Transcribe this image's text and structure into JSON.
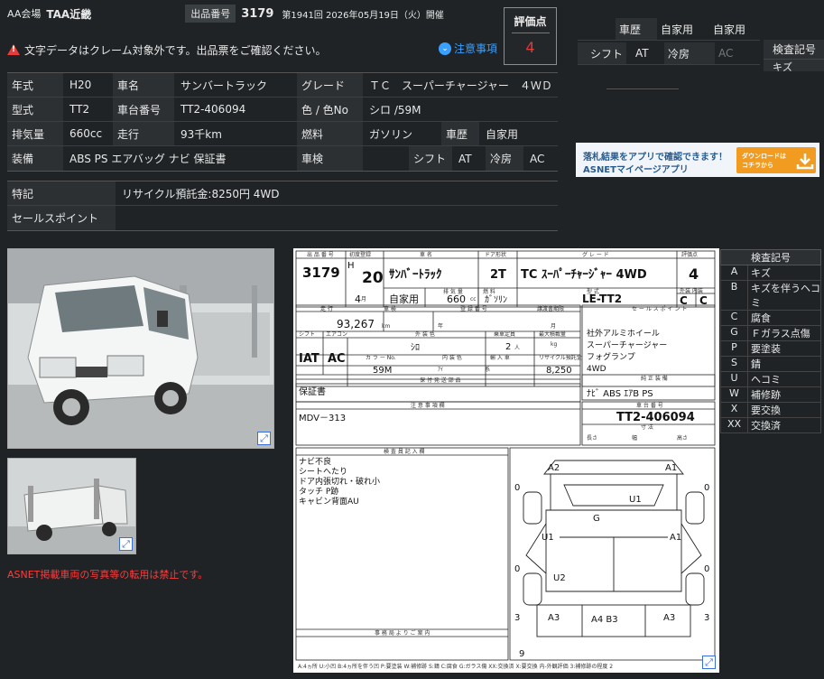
{
  "header": {
    "venue_label": "AA会場",
    "venue": "TAA近畿",
    "lot_label": "出品番号",
    "lot": "3179",
    "session": "第1941回 2026年05月19日（火）開催"
  },
  "warning": {
    "text": "文字データはクレーム対象外です。出品票をご確認ください。",
    "note_link": "注意事項"
  },
  "score": {
    "label": "評価点",
    "value": "4"
  },
  "spec": {
    "rows": [
      [
        {
          "l": "年式",
          "v": "H20"
        },
        {
          "l": "車名",
          "v": "サンバートラック"
        },
        {
          "l": "グレード",
          "v": "ＴＣ　スーパーチャージャー　４ＷＤ"
        }
      ],
      [
        {
          "l": "型式",
          "v": "TT2"
        },
        {
          "l": "車台番号",
          "v": "TT2-406094"
        },
        {
          "l": "色 / 色No",
          "v": "シロ /59M"
        }
      ],
      [
        {
          "l": "排気量",
          "v": "660cc"
        },
        {
          "l": "走行",
          "v": "93千km"
        },
        {
          "l": "燃料",
          "v": "ガソリン"
        },
        {
          "l": "車歴",
          "v": "自家用"
        }
      ],
      [
        {
          "l": "装備",
          "v": "ABS PS エアバッグ ナビ 保証書"
        },
        {
          "l": "車検",
          "v": ""
        },
        {
          "l": "シフト",
          "v": "AT"
        },
        {
          "l": "冷房",
          "v": "AC"
        }
      ]
    ]
  },
  "features": {
    "tokki_label": "特記",
    "tokki": "リサイクル預託金:8250円 4WD",
    "sales_label": "セールスポイント",
    "sales": ""
  },
  "right_table": {
    "r1": [
      "車歴",
      "自家用",
      "自家用"
    ],
    "r2": [
      "シフト",
      "AT",
      "冷房",
      "AC"
    ]
  },
  "kensa_top": {
    "label": "検査記号",
    "value": "キズ"
  },
  "banner": {
    "line1": "落札結果をアプリで確認できます！",
    "line2": "ASNETマイページアプリ",
    "btn1": "ダウンロードは",
    "btn2": "コチラから"
  },
  "photo_notice": "ASNET掲載車両の写真等の転用は禁止です。",
  "sheet": {
    "lot": "3179",
    "era": "H",
    "year": "20",
    "month": "4",
    "car": "ｻﾝﾊﾞｰﾄﾗｯｸ",
    "doors": "2T",
    "grade": "TC ｽｰﾊﾟｰﾁｬｰｼﾞｬｰ 4WD",
    "score": "4",
    "use": "自家用",
    "cc": "660",
    "fuel": "ｶﾞｿﾘﾝ",
    "model": "LE-TT2",
    "ext": "C",
    "int": "C",
    "km": "93,267",
    "shift": "IAT",
    "ac": "AC",
    "color": "ｼﾛ",
    "colorno": "59M",
    "inner": "ｱｲ",
    "seats": "2",
    "recycle": "8,250",
    "sales": [
      "社外アルミホイール",
      "スーパーチャージャー",
      "フォグランプ",
      "4WD"
    ],
    "equip": "ﾅﾋﾞ ABS ｴｱB PS",
    "warranty": "保証書",
    "vin": "TT2-406094",
    "code": "MDV－313",
    "inspect": [
      "ナビ不良",
      "シートへたり",
      "ドア内張切れ・破れ小",
      "タッチ P跡",
      "キャビン背面AU"
    ],
    "marks": {
      "a2": "A2",
      "a1": "A1",
      "u1": "U1",
      "g": "G",
      "u1b": "U1",
      "a1b": "A1",
      "u2": "U2",
      "a3a": "A3",
      "a4b3": "A4 B3",
      "a3b": "A3",
      "z0a": "0",
      "z0b": "0",
      "z0c": "0",
      "z0d": "0",
      "z3a": "3",
      "z3b": "3",
      "z9": "9"
    }
  },
  "legend": {
    "title": "検査記号",
    "items": [
      [
        "A",
        "キズ"
      ],
      [
        "B",
        "キズを伴うヘコミ"
      ],
      [
        "C",
        "腐食"
      ],
      [
        "G",
        "Ｆガラス点傷"
      ],
      [
        "P",
        "要塗装"
      ],
      [
        "S",
        "錆"
      ],
      [
        "U",
        "ヘコミ"
      ],
      [
        "W",
        "補修跡"
      ],
      [
        "X",
        "要交換"
      ],
      [
        "XX",
        "交換済"
      ]
    ]
  }
}
